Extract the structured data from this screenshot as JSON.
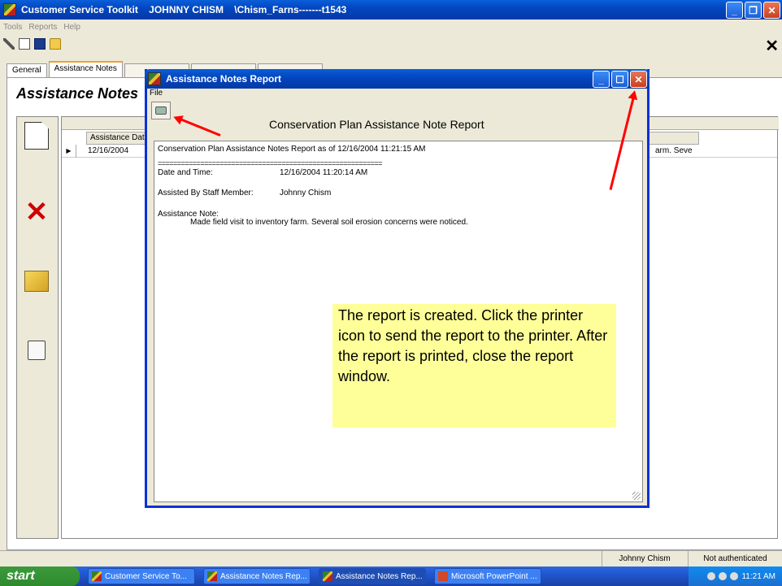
{
  "main_window": {
    "title": "Customer Service Toolkit    JOHNNY CHISM    \\Chism_Farns-------t1543",
    "menu": [
      "Tools",
      "Reports",
      "Help"
    ],
    "minimize": "_",
    "maximize": "❐",
    "close": "✕",
    "app_close": "✕"
  },
  "tabs": [
    {
      "label": "General"
    },
    {
      "label": "Assistance Notes"
    }
  ],
  "page": {
    "heading": "Assistance Notes"
  },
  "grid": {
    "column_header": "Assistance Dat",
    "rows": [
      {
        "marker": "▶",
        "date": "12/16/2004",
        "note_fragment": "arm. Seve"
      }
    ]
  },
  "side_toolbar": {
    "delete_glyph": "✕"
  },
  "dialog": {
    "title": "Assistance Notes Report",
    "menu_file": "File",
    "minimize": "_",
    "maximize": "☐",
    "close": "✕",
    "report_title": "Conservation Plan Assistance Note Report",
    "report": {
      "header_line": "Conservation Plan Assistance Notes Report as of 12/16/2004 11:21:15 AM",
      "separator": "==========================================================",
      "date_label": "Date and Time:",
      "date_value": "12/16/2004 11:20:14 AM",
      "staff_label": "Assisted By Staff Member:",
      "staff_value": "Johnny Chism",
      "note_label": "Assistance Note:",
      "note_text": "Made field visit to inventory farm. Several soil erosion concerns were noticed."
    }
  },
  "callout": {
    "text": "The report is created. Click the printer icon to send the report to the printer. After the report is printed, close the report window."
  },
  "statusbar": {
    "user": "Johnny Chism",
    "auth": "Not authenticated"
  },
  "taskbar": {
    "start": "start",
    "items": [
      {
        "label": "Customer Service To...",
        "icon": "toolkit-icon"
      },
      {
        "label": "Assistance Notes Rep...",
        "icon": "toolkit-icon"
      },
      {
        "label": "Assistance Notes Rep...",
        "icon": "toolkit-icon"
      },
      {
        "label": "Microsoft PowerPoint ...",
        "icon": "powerpoint-icon"
      }
    ],
    "clock": "11:21 AM"
  },
  "colors": {
    "titlebar": "#0347c1",
    "callout": "#ffff99",
    "arrow": "#ff0000"
  }
}
